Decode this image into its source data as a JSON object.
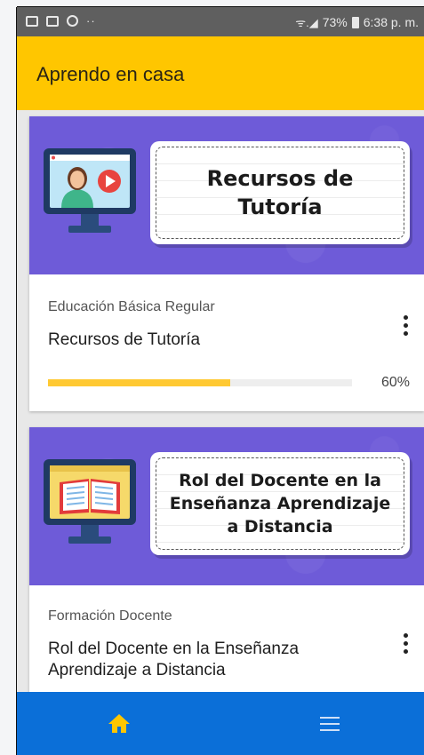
{
  "status_bar": {
    "dots": "··",
    "signal": "ᯤ.◢",
    "battery_pct": "73%",
    "time": "6:38 p. m."
  },
  "app_bar": {
    "title": "Aprendo en casa"
  },
  "colors": {
    "accent": "#ffc600",
    "banner": "#6e5bd8",
    "nav": "#0b6fd8",
    "progress": "#ffc933"
  },
  "courses": [
    {
      "banner_text_line1": "Recursos de",
      "banner_text_line2": "Tutoría",
      "banner_icon": "teacher-monitor-icon",
      "category": "Educación Básica Regular",
      "title": "Recursos de Tutoría",
      "progress": 0.6,
      "progress_label": "60%"
    },
    {
      "banner_text_line1": "Rol del Docente en la",
      "banner_text_line2": "Enseñanza Aprendizaje",
      "banner_text_line3": "a Distancia",
      "banner_icon": "book-monitor-icon",
      "category": "Formación Docente",
      "title": "Rol del Docente en la Enseñanza Aprendizaje a Distancia"
    }
  ],
  "bottom_nav": {
    "home_icon": "home-icon",
    "menu_icon": "menu-icon"
  }
}
